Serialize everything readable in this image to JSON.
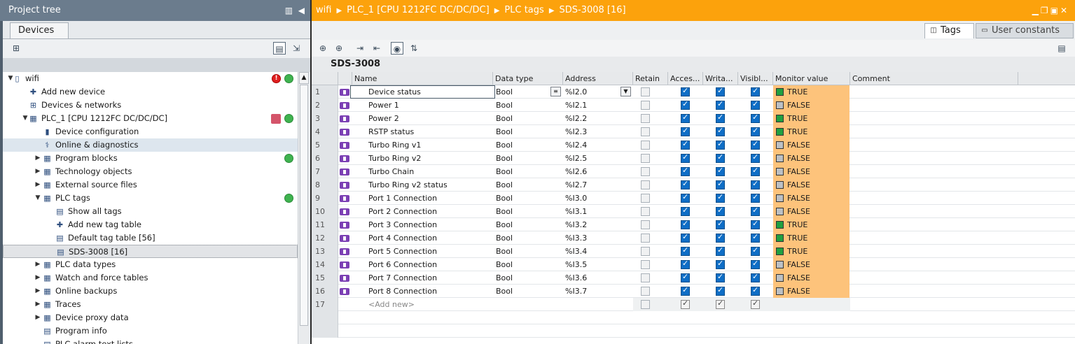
{
  "project_tree": {
    "title": "Project tree",
    "tab": "Devices",
    "items": [
      {
        "label": "wifi",
        "icon": "document-icon"
      },
      {
        "label": "Add new device",
        "icon": "add-device-icon"
      },
      {
        "label": "Devices & networks",
        "icon": "network-icon"
      },
      {
        "label": "PLC_1 [CPU 1212FC DC/DC/DC]",
        "icon": "plc-icon"
      },
      {
        "label": "Device configuration",
        "icon": "device-config-icon"
      },
      {
        "label": "Online & diagnostics",
        "icon": "diagnostics-icon"
      },
      {
        "label": "Program blocks",
        "icon": "folder-icon"
      },
      {
        "label": "Technology objects",
        "icon": "folder-icon"
      },
      {
        "label": "External source files",
        "icon": "folder-icon"
      },
      {
        "label": "PLC tags",
        "icon": "folder-icon"
      },
      {
        "label": "Show all tags",
        "icon": "tag-table-icon"
      },
      {
        "label": "Add new tag table",
        "icon": "add-tag-table-icon"
      },
      {
        "label": "Default tag table [56]",
        "icon": "tag-table-icon"
      },
      {
        "label": "SDS-3008 [16]",
        "icon": "tag-table-icon"
      },
      {
        "label": "PLC data types",
        "icon": "folder-icon"
      },
      {
        "label": "Watch and force tables",
        "icon": "folder-icon"
      },
      {
        "label": "Online backups",
        "icon": "folder-icon"
      },
      {
        "label": "Traces",
        "icon": "folder-icon"
      },
      {
        "label": "Device proxy data",
        "icon": "folder-icon"
      },
      {
        "label": "Program info",
        "icon": "info-icon"
      },
      {
        "label": "PLC alarm text lists",
        "icon": "list-icon"
      }
    ]
  },
  "breadcrumb": {
    "parts": [
      "wifi",
      "PLC_1 [CPU 1212FC DC/DC/DC]",
      "PLC tags",
      "SDS-3008 [16]"
    ]
  },
  "editor_tabs": {
    "tags": "Tags",
    "user_constants": "User constants"
  },
  "table": {
    "title": "SDS-3008",
    "columns": [
      "Name",
      "Data type",
      "Address",
      "Retain",
      "Acces...",
      "Writa...",
      "Visibl...",
      "Monitor value",
      "Comment"
    ],
    "rows": [
      {
        "num": "1",
        "name": "Device status",
        "type": "Bool",
        "address": "%I2.0",
        "monitor": "TRUE"
      },
      {
        "num": "2",
        "name": "Power 1",
        "type": "Bool",
        "address": "%I2.1",
        "monitor": "FALSE"
      },
      {
        "num": "3",
        "name": "Power 2",
        "type": "Bool",
        "address": "%I2.2",
        "monitor": "TRUE"
      },
      {
        "num": "4",
        "name": "RSTP status",
        "type": "Bool",
        "address": "%I2.3",
        "monitor": "TRUE"
      },
      {
        "num": "5",
        "name": "Turbo Ring v1",
        "type": "Bool",
        "address": "%I2.4",
        "monitor": "FALSE"
      },
      {
        "num": "6",
        "name": "Turbo Ring v2",
        "type": "Bool",
        "address": "%I2.5",
        "monitor": "FALSE"
      },
      {
        "num": "7",
        "name": "Turbo Chain",
        "type": "Bool",
        "address": "%I2.6",
        "monitor": "FALSE"
      },
      {
        "num": "8",
        "name": "Turbo Ring v2 status",
        "type": "Bool",
        "address": "%I2.7",
        "monitor": "FALSE"
      },
      {
        "num": "9",
        "name": "Port 1 Connection",
        "type": "Bool",
        "address": "%I3.0",
        "monitor": "FALSE"
      },
      {
        "num": "10",
        "name": "Port 2 Connection",
        "type": "Bool",
        "address": "%I3.1",
        "monitor": "FALSE"
      },
      {
        "num": "11",
        "name": "Port 3 Connection",
        "type": "Bool",
        "address": "%I3.2",
        "monitor": "TRUE"
      },
      {
        "num": "12",
        "name": "Port 4 Connection",
        "type": "Bool",
        "address": "%I3.3",
        "monitor": "TRUE"
      },
      {
        "num": "13",
        "name": "Port 5 Connection",
        "type": "Bool",
        "address": "%I3.4",
        "monitor": "TRUE"
      },
      {
        "num": "14",
        "name": "Port 6 Connection",
        "type": "Bool",
        "address": "%I3.5",
        "monitor": "FALSE"
      },
      {
        "num": "15",
        "name": "Port 7 Connection",
        "type": "Bool",
        "address": "%I3.6",
        "monitor": "FALSE"
      },
      {
        "num": "16",
        "name": "Port 8 Connection",
        "type": "Bool",
        "address": "%I3.7",
        "monitor": "FALSE"
      }
    ],
    "add_row": {
      "num": "17",
      "name": "<Add new>"
    }
  },
  "colors": {
    "breadcrumb_bg": "#fca20c",
    "tree_title_bg": "#6b7c8d",
    "monitor_bg": "#fdc37b",
    "true_indicator": "#20a040",
    "false_indicator": "#bcc0c4",
    "tag_icon": "#7b3fb4"
  }
}
